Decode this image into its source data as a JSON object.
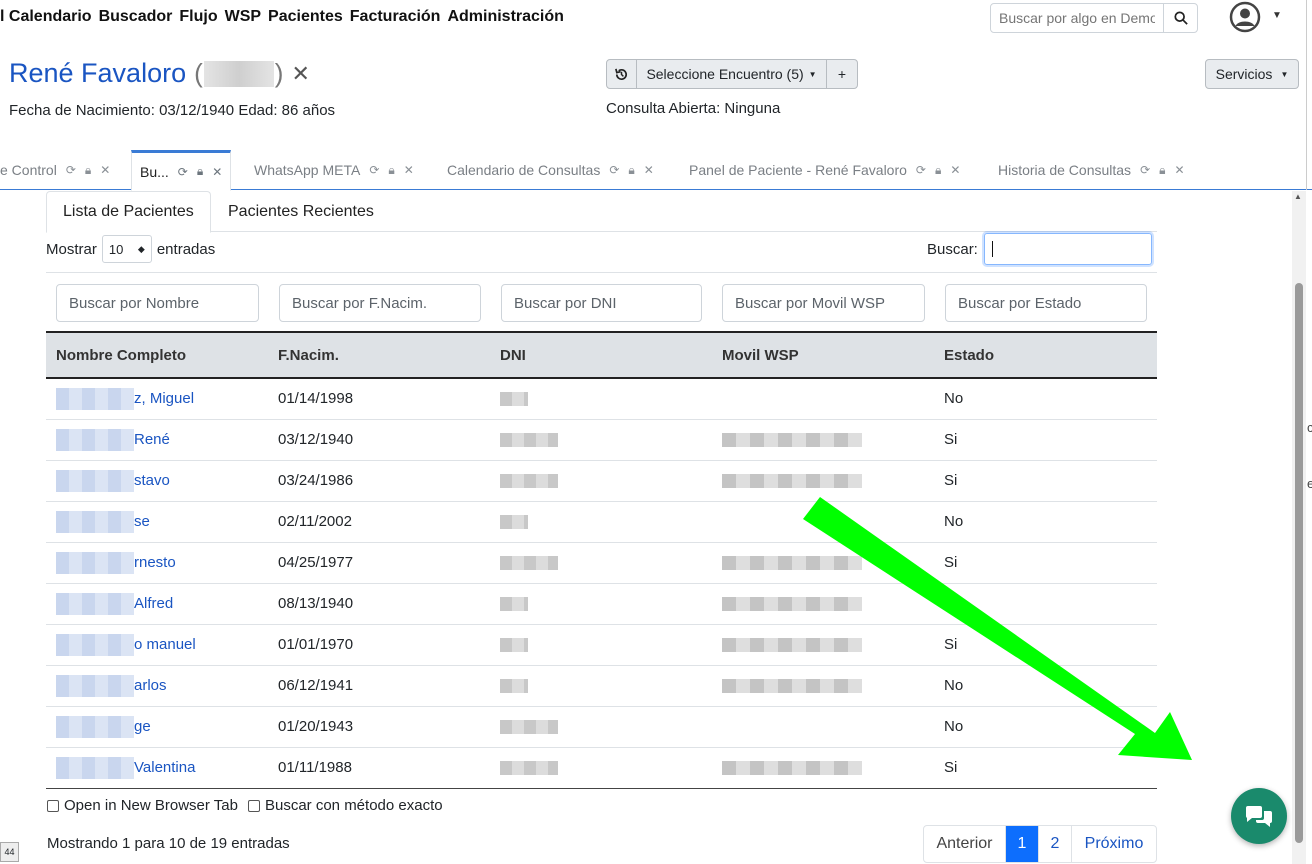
{
  "nav": {
    "items": [
      "l Calendario",
      "Buscador",
      "Flujo",
      "WSP",
      "Pacientes",
      "Facturación",
      "Administración"
    ],
    "search_placeholder": "Buscar por algo en Demo"
  },
  "patient": {
    "name": "René Favaloro",
    "open_paren": "(",
    "close_paren": ")",
    "dob_line": "Fecha de Nacimiento: 03/12/1940 Edad: 86 años"
  },
  "encounter": {
    "select_label": "Seleccione Encuentro  (5)",
    "add_label": "+",
    "consulta": "Consulta Abierta: Ninguna"
  },
  "servicios_label": "Servicios",
  "window_tabs": [
    {
      "label": "e Control"
    },
    {
      "label": "Bu..."
    },
    {
      "label": "WhatsApp META"
    },
    {
      "label": "Calendario de Consultas"
    },
    {
      "label": "Panel de Paciente - René Favaloro"
    },
    {
      "label": "Historia de Consultas"
    }
  ],
  "inner_tabs": [
    "Lista de Pacientes",
    "Pacientes Recientes"
  ],
  "length": {
    "mostrar": "Mostrar",
    "value": "10",
    "entradas": "entradas"
  },
  "filter": {
    "label": "Buscar:"
  },
  "column_search": [
    "Buscar por Nombre",
    "Buscar por F.Nacim.",
    "Buscar por DNI",
    "Buscar por Movil WSP",
    "Buscar por Estado"
  ],
  "table": {
    "headers": [
      "Nombre Completo",
      "F.Nacim.",
      "DNI",
      "Movil WSP",
      "Estado"
    ],
    "rows": [
      {
        "name": "z, Miguel",
        "dob": "01/14/1998",
        "dni": "short",
        "phone": false,
        "estado": "No"
      },
      {
        "name": "René",
        "dob": "03/12/1940",
        "dni": "long",
        "phone": true,
        "estado": "Si"
      },
      {
        "name": "stavo",
        "dob": "03/24/1986",
        "dni": "long",
        "phone": true,
        "estado": "Si"
      },
      {
        "name": "se",
        "dob": "02/11/2002",
        "dni": "short",
        "phone": false,
        "estado": "No"
      },
      {
        "name": "rnesto",
        "dob": "04/25/1977",
        "dni": "long",
        "phone": true,
        "estado": "Si"
      },
      {
        "name": "Alfred",
        "dob": "08/13/1940",
        "dni": "short",
        "phone": true,
        "estado": ""
      },
      {
        "name": "o manuel",
        "dob": "01/01/1970",
        "dni": "short",
        "phone": true,
        "estado": "Si"
      },
      {
        "name": "arlos",
        "dob": "06/12/1941",
        "dni": "short",
        "phone": true,
        "estado": "No"
      },
      {
        "name": "ge",
        "dob": "01/20/1943",
        "dni": "long",
        "phone": false,
        "estado": "No"
      },
      {
        "name": "Valentina",
        "dob": "01/11/1988",
        "dni": "long",
        "phone": true,
        "estado": "Si"
      }
    ]
  },
  "options": {
    "new_tab": "Open in New Browser Tab",
    "exact": "Buscar con método exacto"
  },
  "info": "Mostrando 1 para 10 de 19 entradas",
  "pager": {
    "prev": "Anterior",
    "p1": "1",
    "p2": "2",
    "next": "Próximo"
  },
  "corner_badge": "44",
  "edge_letters": [
    "c",
    "e"
  ],
  "colors": {
    "link": "#1a55c2",
    "arrow": "#00ff00",
    "chat": "#1a8a6c",
    "active_page": "#0d6efd"
  }
}
